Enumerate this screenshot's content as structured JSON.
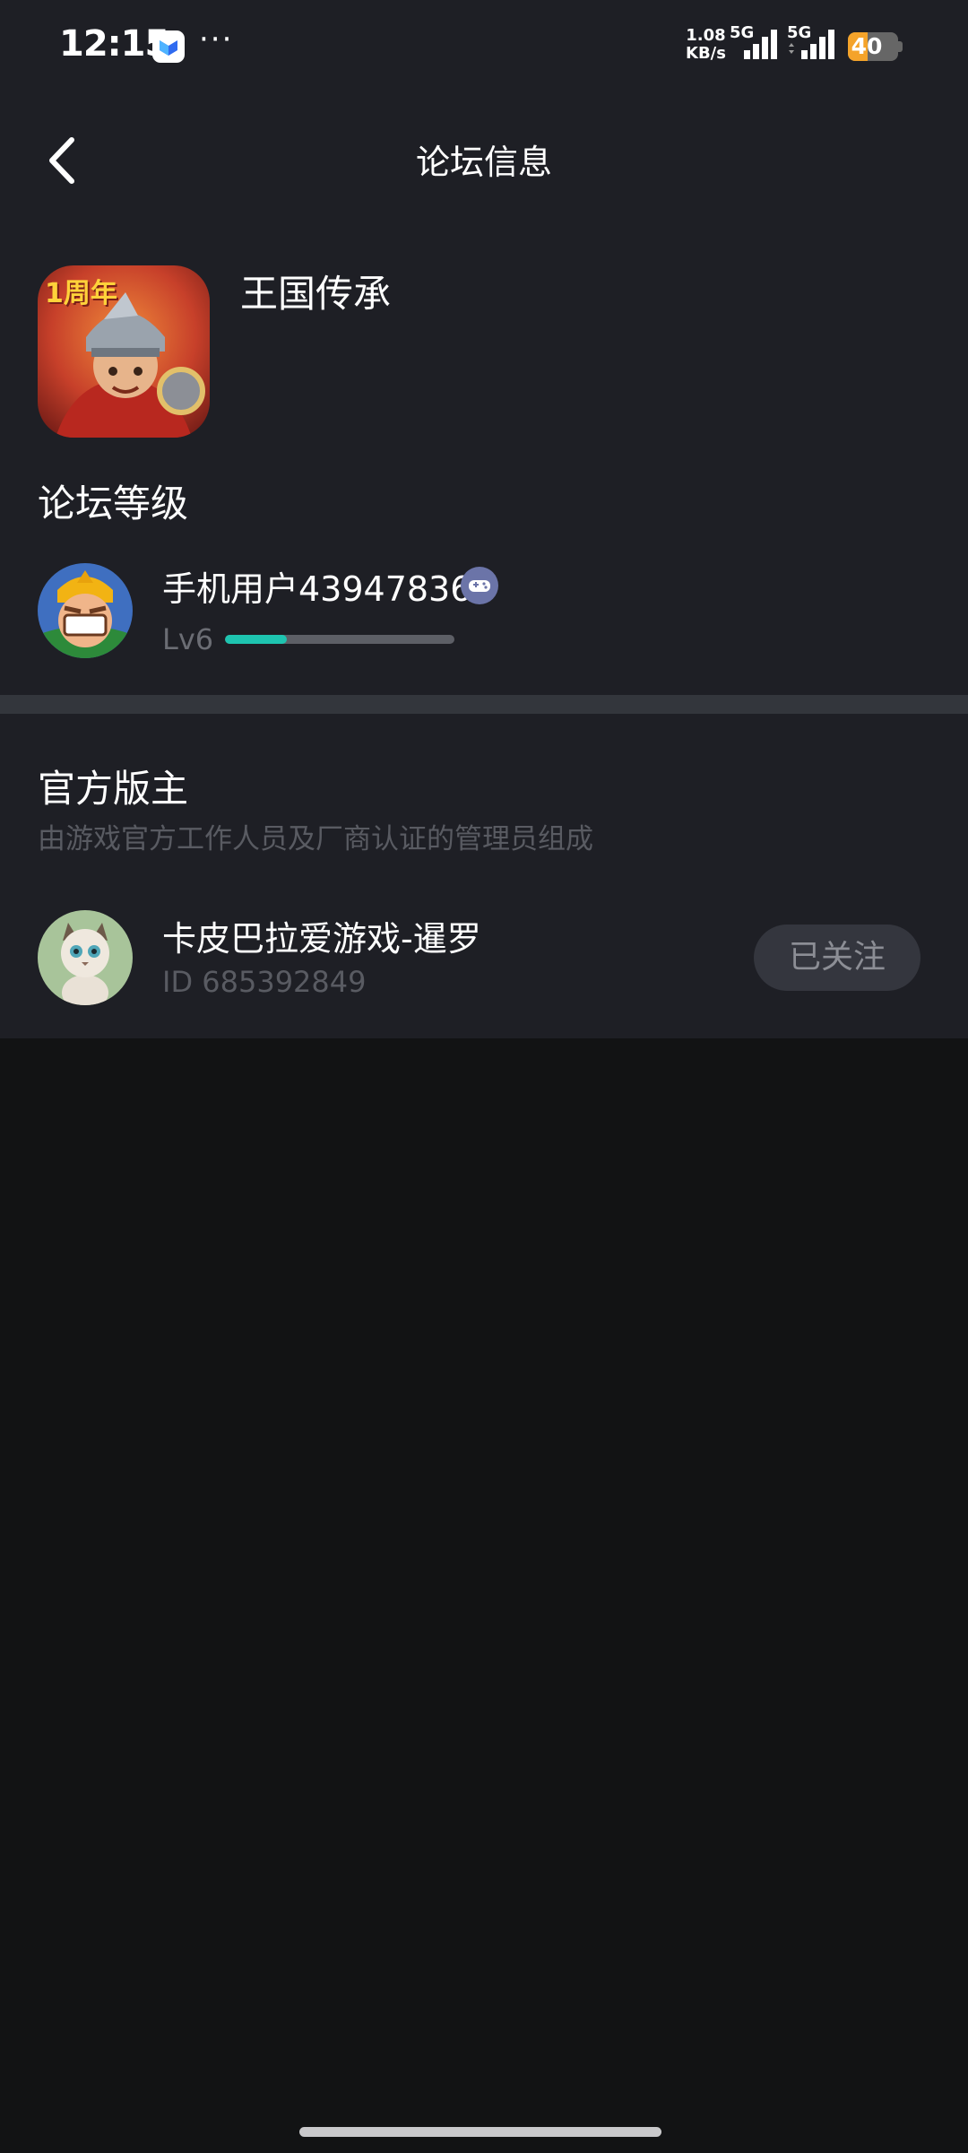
{
  "status_bar": {
    "time": "12:15",
    "more": "···",
    "net_speed_value": "1.08",
    "net_speed_unit": "KB/s",
    "sim1": "5G",
    "sim2": "5G",
    "battery": "40",
    "battery_level": 0.4,
    "battery_color": "#f4a32a"
  },
  "header": {
    "title": "论坛信息",
    "back_icon": "chevron-left-icon"
  },
  "game": {
    "name": "王国传承",
    "icon_badge": "1周年"
  },
  "forum_level": {
    "title": "论坛等级",
    "username": "手机用户43947836",
    "level": "Lv6",
    "progress": 0.27,
    "progress_color": "#1ec4b0"
  },
  "moderators": {
    "title": "官方版主",
    "subtitle": "由游戏官方工作人员及厂商认证的管理员组成",
    "items": [
      {
        "name": "卡皮巴拉爱游戏-暹罗",
        "id": "ID 685392849",
        "follow_label": "已关注"
      }
    ]
  }
}
